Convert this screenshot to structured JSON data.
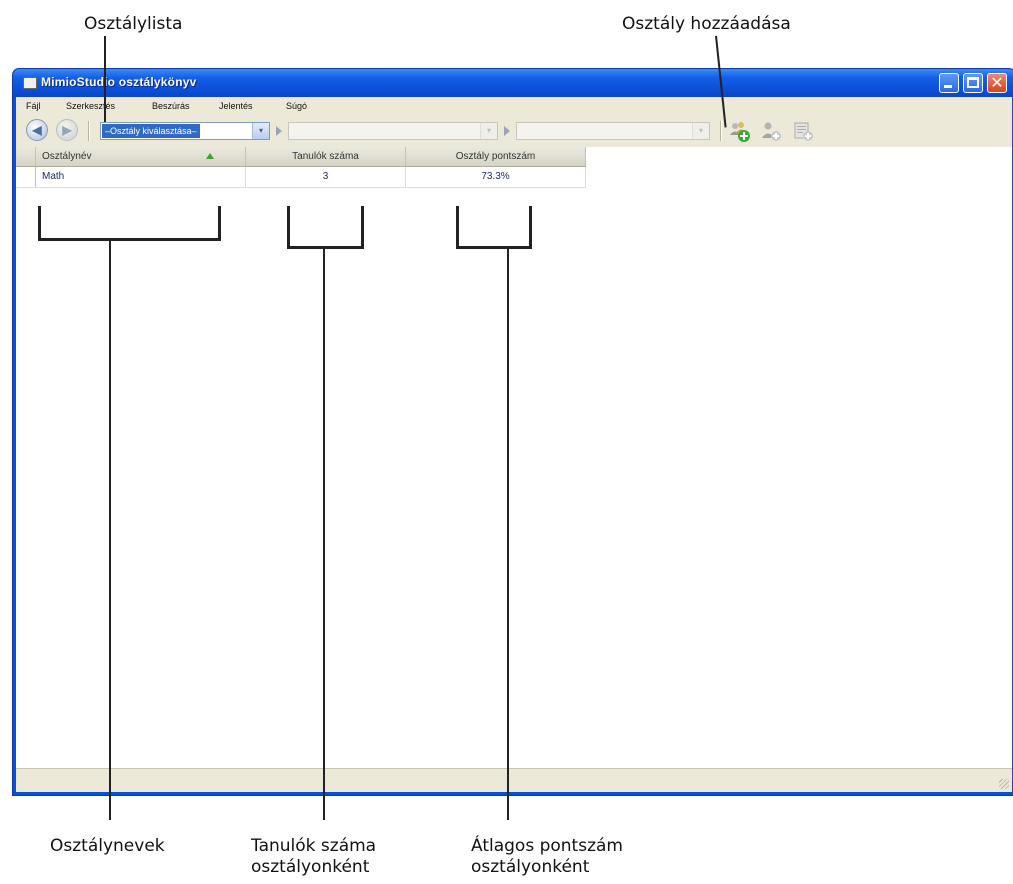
{
  "annotations": {
    "class_list": "Osztálylista",
    "add_class": "Osztály hozzáadása",
    "class_names": "Osztálynevek",
    "students_line1": "Tanulók száma",
    "students_line2": "osztályonként",
    "average_line1": "Átlagos pontszám",
    "average_line2": "osztályonként"
  },
  "window": {
    "title": "MimioStudio osztálykönyv",
    "controls": {
      "minimize": "minimize-icon",
      "maximize": "maximize-icon",
      "close_glyph": "✕"
    }
  },
  "menu": [
    {
      "label": "Fájl"
    },
    {
      "label": "Szerkesztés"
    },
    {
      "label": "Beszúrás"
    },
    {
      "label": "Jelentés"
    },
    {
      "label": "Súgó"
    }
  ],
  "toolbar": {
    "back_glyph": "◀",
    "forward_glyph": "▶",
    "class_select_value": "–Osztály kiválasztása–",
    "dropdown_glyph": "▾",
    "icons": [
      "add-class-icon",
      "add-student-icon",
      "add-lesson-icon"
    ]
  },
  "grid": {
    "columns": [
      "Osztálynév",
      "Tanulók száma",
      "Osztály pontszám"
    ],
    "sort_column": "Osztálynév",
    "sort_direction": "ascending",
    "rows": [
      {
        "name": "Math",
        "students": "3",
        "score": "73.3%"
      }
    ]
  },
  "colors": {
    "titlebar": "#0c4fd8",
    "selection": "#316ac5",
    "chrome": "#ece9d8",
    "sort_indicator": "#39a32d",
    "add_icon_green": "#3aa83a"
  }
}
